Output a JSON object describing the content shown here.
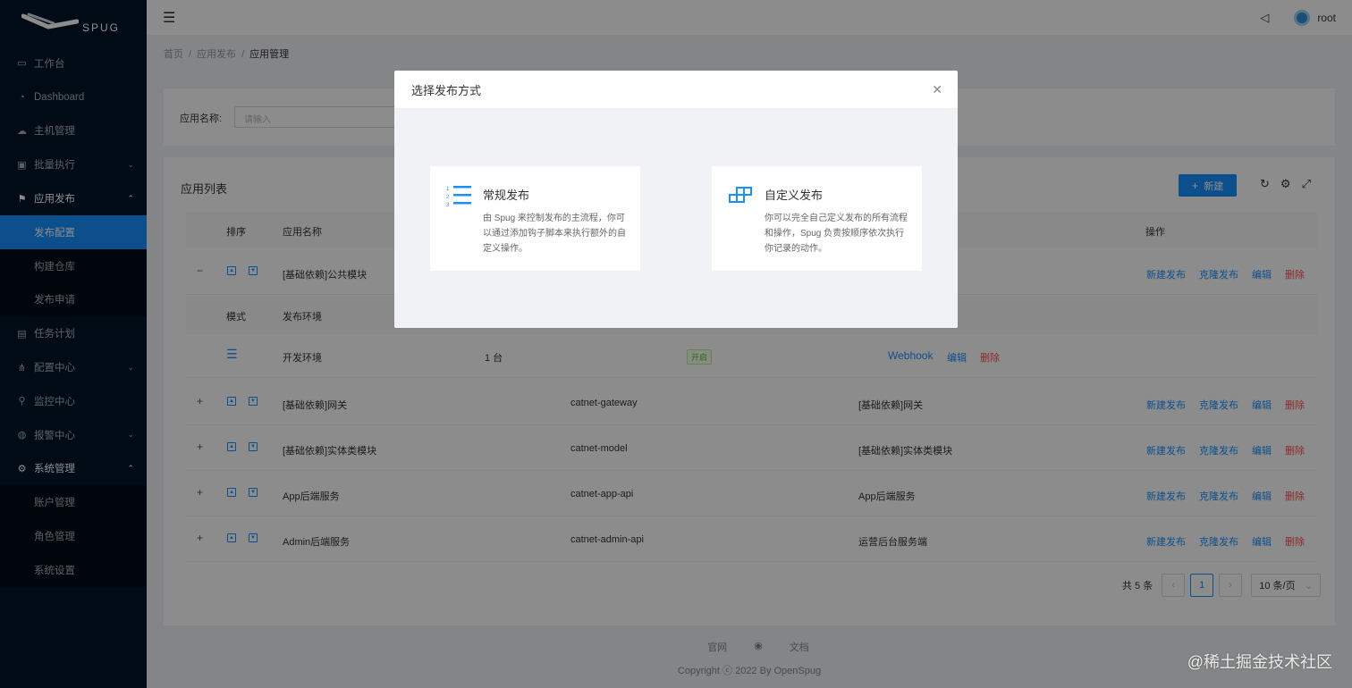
{
  "brand": {
    "name": "SPUG"
  },
  "sidebar": {
    "items": [
      {
        "label": "工作台",
        "icon": "desktop-icon"
      },
      {
        "label": "Dashboard",
        "icon": "dashboard-icon"
      },
      {
        "label": "主机管理",
        "icon": "cloud-server-icon"
      },
      {
        "label": "批量执行",
        "icon": "code-icon"
      },
      {
        "label": "应用发布",
        "icon": "flag-icon"
      },
      {
        "label": "发布配置"
      },
      {
        "label": "构建仓库"
      },
      {
        "label": "发布申请"
      },
      {
        "label": "任务计划",
        "icon": "schedule-icon"
      },
      {
        "label": "配置中心",
        "icon": "deployment-icon"
      },
      {
        "label": "监控中心",
        "icon": "monitor-icon"
      },
      {
        "label": "报警中心",
        "icon": "alert-icon"
      },
      {
        "label": "系统管理",
        "icon": "setting-icon"
      },
      {
        "label": "账户管理"
      },
      {
        "label": "角色管理"
      },
      {
        "label": "系统设置"
      }
    ]
  },
  "header": {
    "username": "root"
  },
  "breadcrumb": [
    "首页",
    "应用发布",
    "应用管理"
  ],
  "search": {
    "label": "应用名称:",
    "placeholder": "请输入"
  },
  "table": {
    "title": "应用列表",
    "new_label": "新建",
    "columns": {
      "sort": "排序",
      "name": "应用名称",
      "action": "操作"
    },
    "sub_columns": {
      "mode": "模式",
      "env": "发布环境"
    },
    "sub_row": {
      "env": "开发环境",
      "hosts": "1 台",
      "status": "开启",
      "webhook": "Webhook",
      "edit": "编辑",
      "delete": "删除"
    },
    "rows": [
      {
        "name": "[基础依赖]公共模块",
        "key": "",
        "desc": ""
      },
      {
        "name": "[基础依赖]网关",
        "key": "catnet-gateway",
        "desc": "[基础依赖]网关"
      },
      {
        "name": "[基础依赖]实体类模块",
        "key": "catnet-model",
        "desc": "[基础依赖]实体类模块"
      },
      {
        "name": "App后端服务",
        "key": "catnet-app-api",
        "desc": "App后端服务"
      },
      {
        "name": "Admin后端服务",
        "key": "catnet-admin-api",
        "desc": "运营后台服务端"
      }
    ],
    "actions": {
      "deploy": "新建发布",
      "clone": "克隆发布",
      "edit": "编辑",
      "delete": "删除"
    }
  },
  "pagination": {
    "total": "共 5 条",
    "current": "1",
    "page_size": "10 条/页"
  },
  "footer": {
    "link1": "官网",
    "link2": "文档",
    "copyright": "Copyright ⓒ 2022 By OpenSpug"
  },
  "modal": {
    "title": "选择发布方式",
    "options": [
      {
        "title": "常规发布",
        "desc": "由 Spug 来控制发布的主流程，你可以通过添加钩子脚本来执行额外的自定义操作。"
      },
      {
        "title": "自定义发布",
        "desc": "你可以完全自己定义发布的所有流程和操作，Spug 负责按顺序依次执行你记录的动作。"
      }
    ]
  },
  "watermark": "@稀土掘金技术社区",
  "colors": {
    "primary": "#1890ff",
    "danger": "#ff4d4f",
    "sidebar": "#001529",
    "success": "#52c41a"
  }
}
